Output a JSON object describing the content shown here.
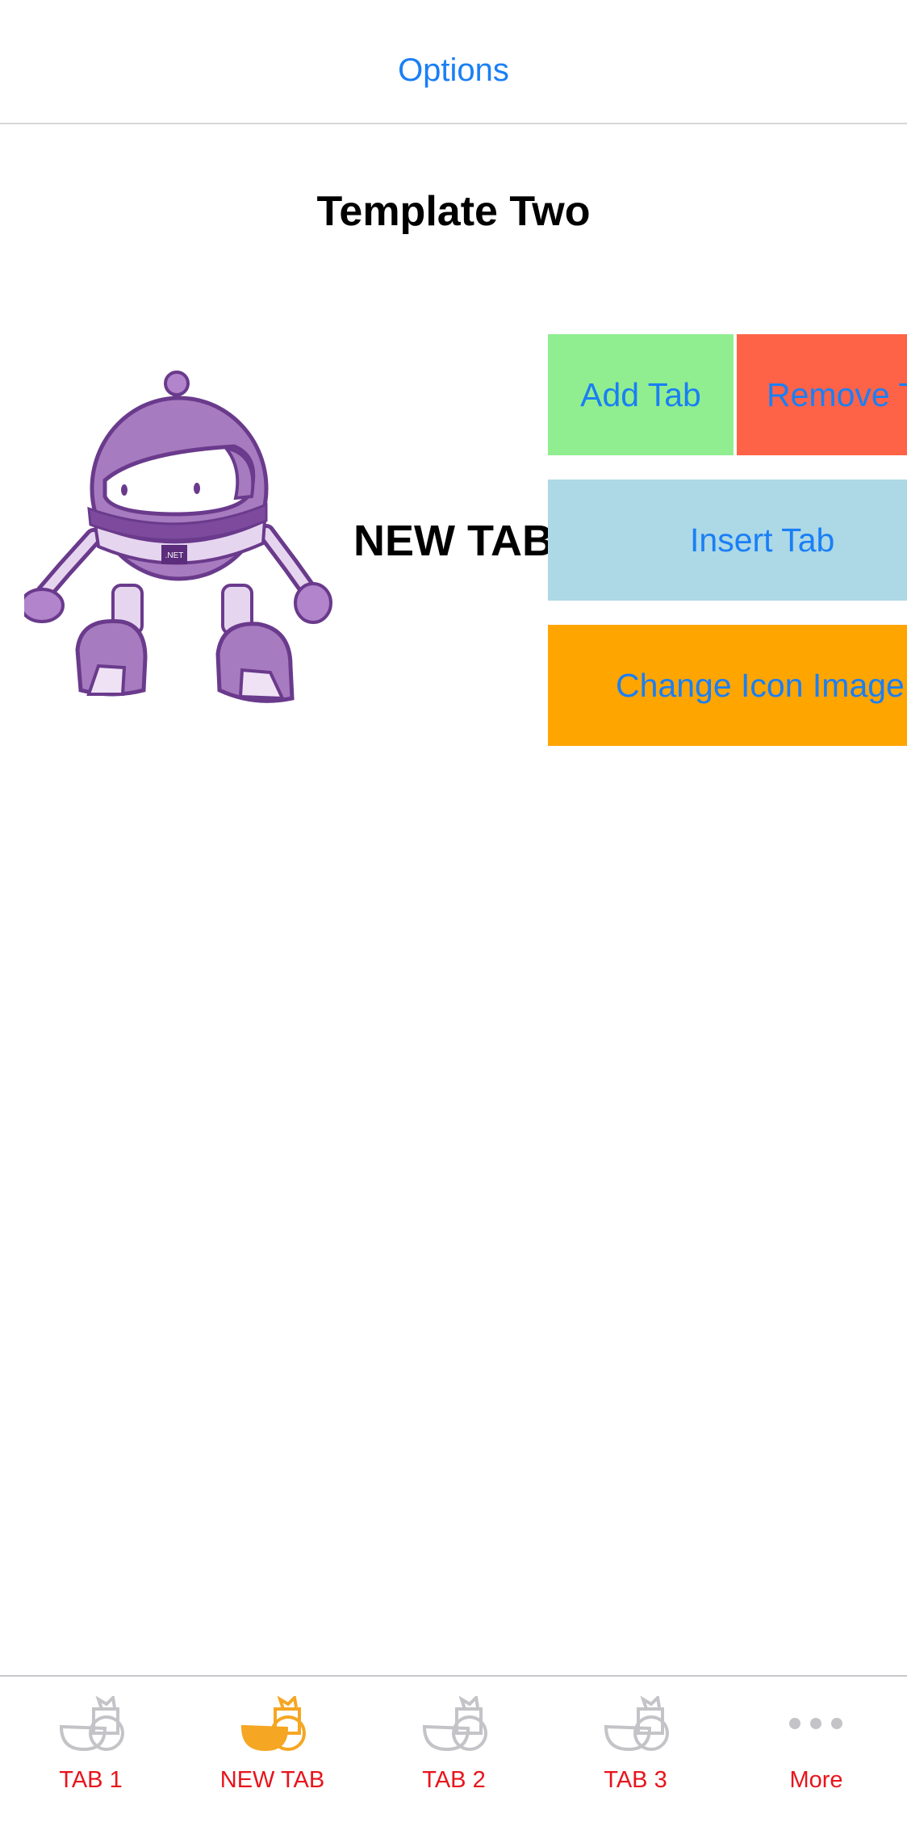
{
  "nav": {
    "options_label": "Options"
  },
  "page": {
    "title": "Template Two",
    "content_label": "NEW TAB"
  },
  "buttons": {
    "add": "Add Tab",
    "remove": "Remove Tab",
    "insert": "Insert Tab",
    "change_icon": "Change Icon Image"
  },
  "tabs": [
    {
      "label": "TAB 1",
      "icon": "tab-fruit-icon",
      "selected": false
    },
    {
      "label": "NEW TAB",
      "icon": "tab-fruit-icon",
      "selected": true
    },
    {
      "label": "TAB 2",
      "icon": "tab-fruit-icon",
      "selected": false
    },
    {
      "label": "TAB 3",
      "icon": "tab-fruit-icon",
      "selected": false
    },
    {
      "label": "More",
      "icon": "more-icon",
      "selected": false
    }
  ],
  "colors": {
    "accent_blue": "#1a7ff5",
    "tab_label_red": "#e8141c",
    "selected_icon": "#f5a623",
    "unselected_icon": "#c4c4c8",
    "add_button": "#90ee90",
    "remove_button": "#ff6347",
    "insert_button": "#add8e6",
    "change_button": "#ffa500",
    "bot_purple": "#a77bbf"
  }
}
